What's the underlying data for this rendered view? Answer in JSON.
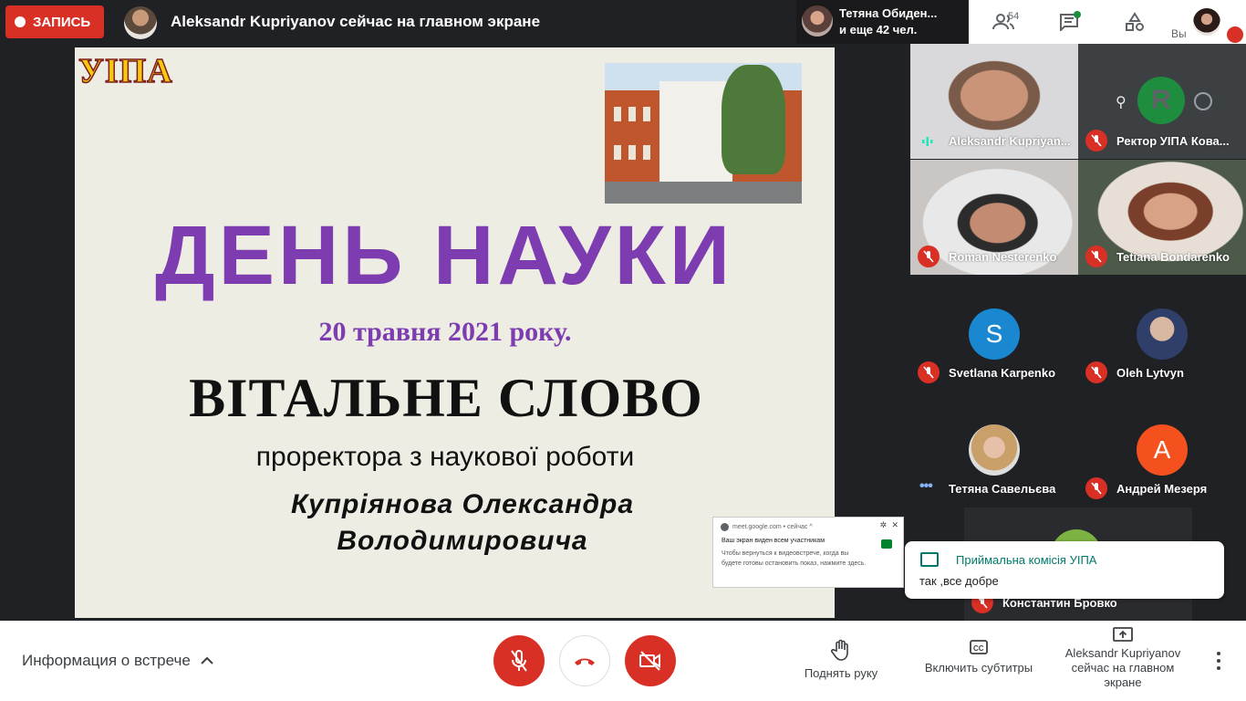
{
  "topbar": {
    "record_label": "ЗАПИСЬ",
    "presenter_text": "Aleksandr Kupriyanov сейчас на главном экране",
    "viewers_line1": "Тетяна Обиден...",
    "viewers_line2": "и еще 42 чел.",
    "people_count": "54",
    "you_label": "Вы"
  },
  "slide": {
    "logo": "УІПА",
    "title": "ДЕНЬ НАУКИ",
    "date": "20 травня 2021 року.",
    "heading": "ВІТАЛЬНЕ СЛОВО",
    "subheading": "проректора з наукової роботи",
    "name_line1": "Купріянова Олександра",
    "name_line2": "Володимировича"
  },
  "share_popup": {
    "site": "meet.google.com • сейчас ^",
    "line1": "Ваш экран виден всем участникам",
    "line2": "Чтобы вернуться к видеовстрече, когда вы будете готовы остановить показ, нажмите здесь."
  },
  "tiles": [
    {
      "name": "Aleksandr Kupriyan...",
      "state": "speaking"
    },
    {
      "name": "Ректор УІПА Кова...",
      "state": "muted",
      "initial": "R"
    },
    {
      "name": "Roman Nesterenko",
      "state": "muted"
    },
    {
      "name": "Tetiana Bondarenko",
      "state": "muted"
    },
    {
      "name": "Svetlana Karpenko",
      "state": "muted",
      "initial": "S",
      "color": "#1a88d0"
    },
    {
      "name": "Oleh Lytvyn",
      "state": "muted"
    },
    {
      "name": "Тетяна Савельєва",
      "state": "dots"
    },
    {
      "name": "Андрей Мезеря",
      "state": "muted",
      "initial": "А",
      "color": "#f4511e"
    },
    {
      "name": "Константин Бровко",
      "state": "muted"
    }
  ],
  "chat": {
    "sender": "Приймальна комісія УІПА",
    "message": "так ,все добре"
  },
  "bottombar": {
    "meeting_info": "Информация о встрече",
    "raise_hand": "Поднять руку",
    "captions": "Включить субтитры",
    "present_line1": "Aleksandr Kupriyanov",
    "present_line2": "сейчас на главном",
    "present_line3": "экране"
  }
}
